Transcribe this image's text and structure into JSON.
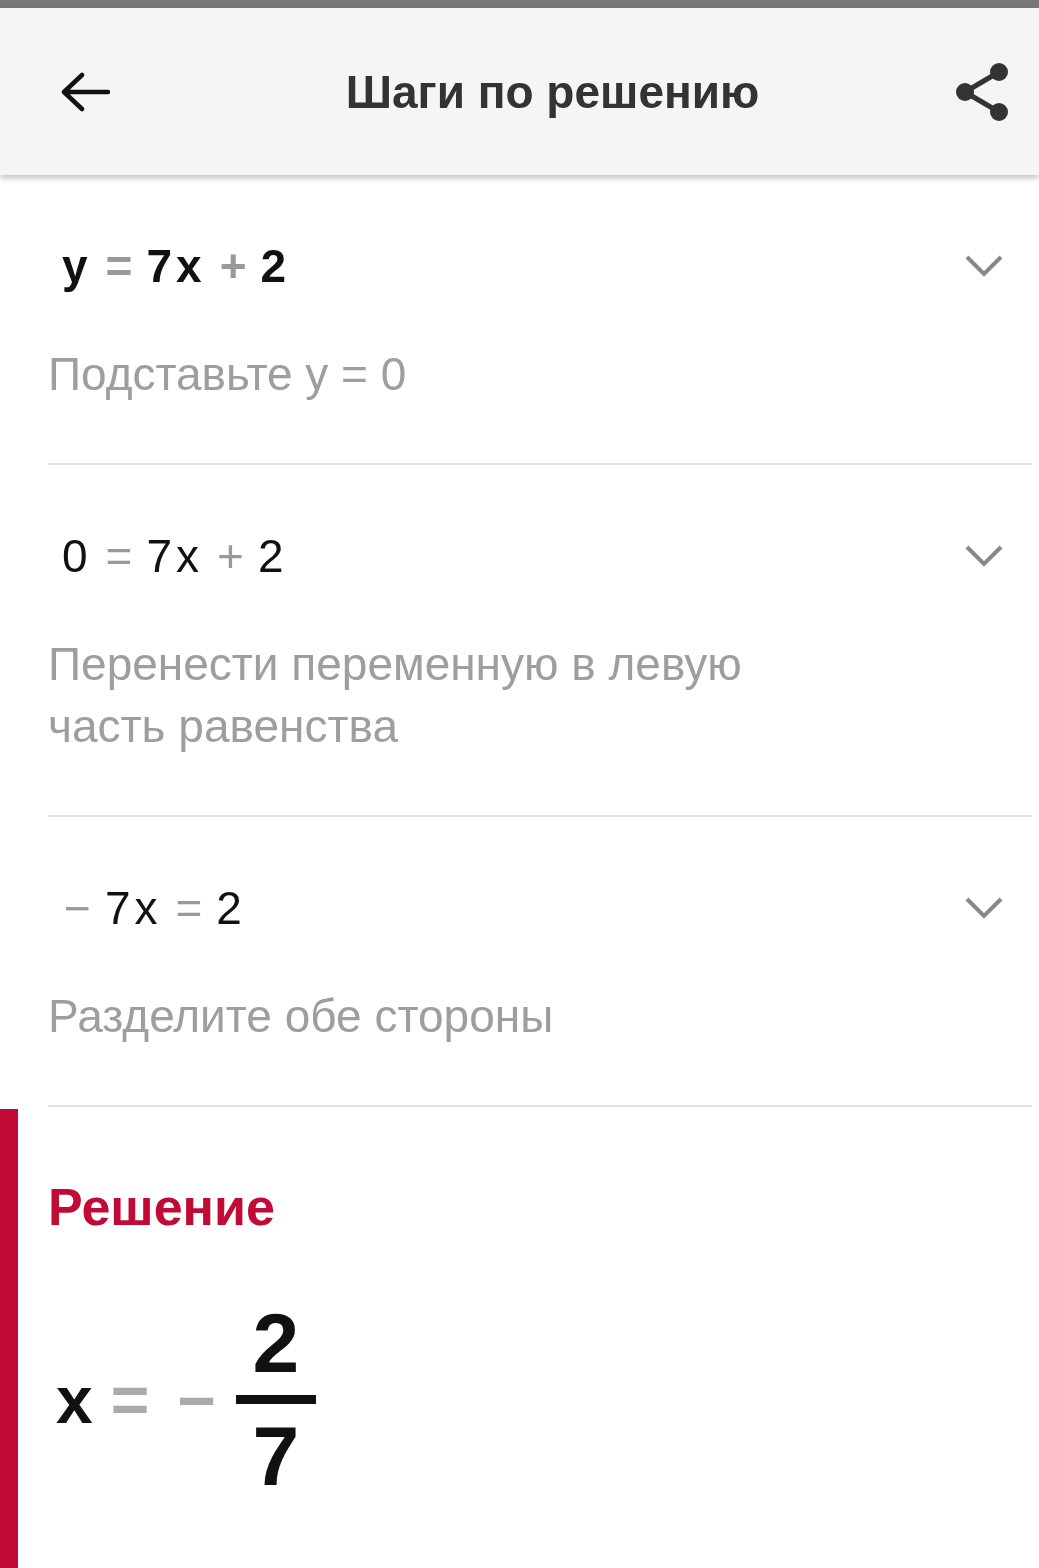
{
  "header": {
    "title": "Шаги по решению"
  },
  "steps": [
    {
      "bold": true,
      "equation": [
        {
          "text": "y",
          "kind": "term"
        },
        {
          "text": "=",
          "kind": "op"
        },
        {
          "text": "7x",
          "kind": "term"
        },
        {
          "text": "+",
          "kind": "op"
        },
        {
          "text": "2",
          "kind": "term"
        }
      ],
      "description": "Подставьте y = 0"
    },
    {
      "bold": false,
      "equation": [
        {
          "text": "0",
          "kind": "term"
        },
        {
          "text": "=",
          "kind": "op"
        },
        {
          "text": "7x",
          "kind": "term"
        },
        {
          "text": "+",
          "kind": "op"
        },
        {
          "text": "2",
          "kind": "term"
        }
      ],
      "description": "Перенести переменную в левую часть равенства"
    },
    {
      "bold": false,
      "equation": [
        {
          "text": "−",
          "kind": "op"
        },
        {
          "text": "7x",
          "kind": "term"
        },
        {
          "text": "=",
          "kind": "op"
        },
        {
          "text": "2",
          "kind": "term"
        }
      ],
      "description": "Разделите обе стороны"
    }
  ],
  "solution": {
    "heading": "Решение",
    "lhs": [
      {
        "text": "x",
        "kind": "term"
      },
      {
        "text": "=",
        "kind": "op"
      },
      {
        "text": "−",
        "kind": "op"
      }
    ],
    "numerator": "2",
    "denominator": "7"
  }
}
